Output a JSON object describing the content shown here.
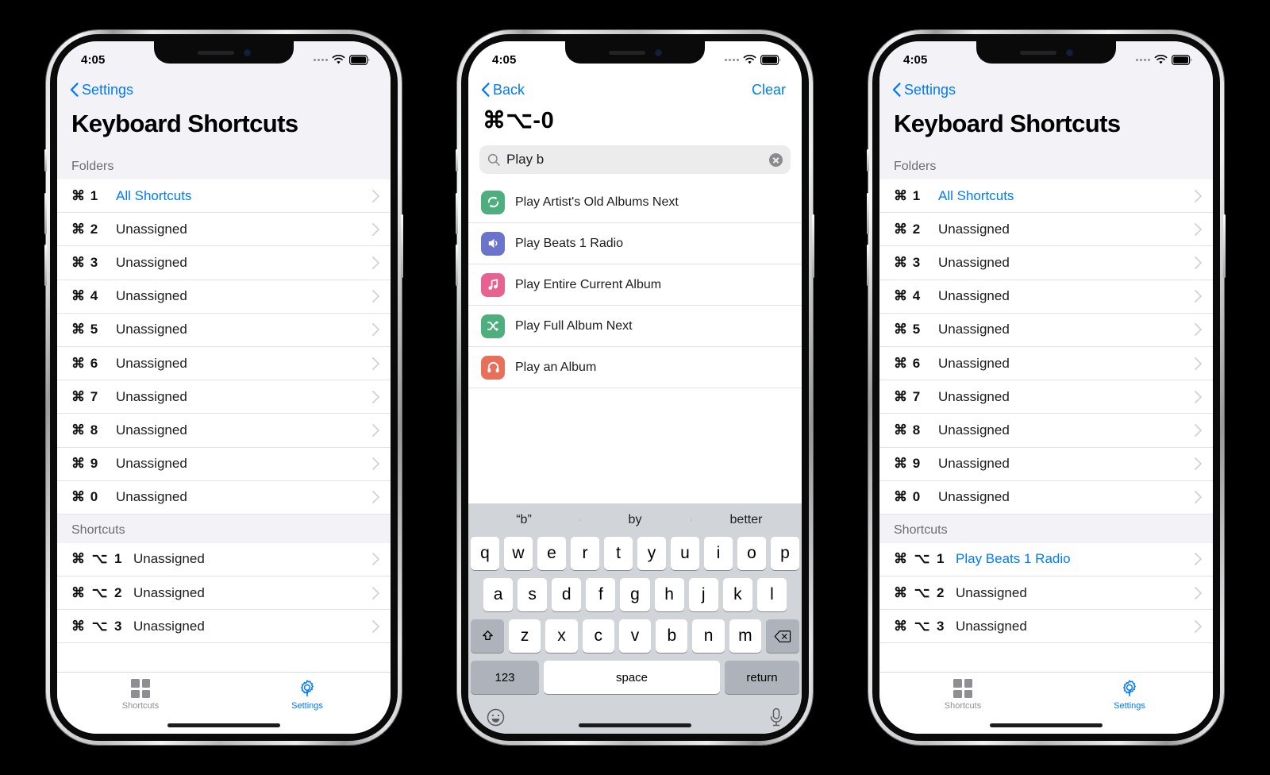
{
  "status": {
    "time": "4:05"
  },
  "phone1": {
    "nav": {
      "back_label": "Settings"
    },
    "title": "Keyboard Shortcuts",
    "sections": [
      {
        "header": "Folders",
        "rows": [
          {
            "keys": "⌘ 1",
            "label": "All Shortcuts",
            "blue": true
          },
          {
            "keys": "⌘ 2",
            "label": "Unassigned",
            "blue": false
          },
          {
            "keys": "⌘ 3",
            "label": "Unassigned",
            "blue": false
          },
          {
            "keys": "⌘ 4",
            "label": "Unassigned",
            "blue": false
          },
          {
            "keys": "⌘ 5",
            "label": "Unassigned",
            "blue": false
          },
          {
            "keys": "⌘ 6",
            "label": "Unassigned",
            "blue": false
          },
          {
            "keys": "⌘ 7",
            "label": "Unassigned",
            "blue": false
          },
          {
            "keys": "⌘ 8",
            "label": "Unassigned",
            "blue": false
          },
          {
            "keys": "⌘ 9",
            "label": "Unassigned",
            "blue": false
          },
          {
            "keys": "⌘ 0",
            "label": "Unassigned",
            "blue": false
          }
        ]
      },
      {
        "header": "Shortcuts",
        "rows": [
          {
            "keys": "⌘ ⌥ 1",
            "label": "Unassigned",
            "blue": false
          },
          {
            "keys": "⌘ ⌥ 2",
            "label": "Unassigned",
            "blue": false
          },
          {
            "keys": "⌘ ⌥ 3",
            "label": "Unassigned",
            "blue": false
          }
        ]
      }
    ],
    "tabs": [
      {
        "label": "Shortcuts",
        "icon": "grid-icon",
        "active": false
      },
      {
        "label": "Settings",
        "icon": "gear-icon",
        "active": true
      }
    ]
  },
  "phone2": {
    "nav": {
      "back_label": "Back",
      "action_label": "Clear"
    },
    "title": "⌘⌥-0",
    "search": {
      "value": "Play b",
      "placeholder": "Search"
    },
    "results": [
      {
        "label": "Play Artist's Old Albums Next",
        "icon": "refresh-icon",
        "color": "#4fae7e"
      },
      {
        "label": "Play Beats 1 Radio",
        "icon": "speaker-icon",
        "color": "#6b74ca"
      },
      {
        "label": "Play Entire Current Album",
        "icon": "music-note-icon",
        "color": "#e8628f"
      },
      {
        "label": "Play Full Album Next",
        "icon": "shuffle-icon",
        "color": "#4fae7e"
      },
      {
        "label": "Play an Album",
        "icon": "headphones-icon",
        "color": "#e8705a"
      }
    ],
    "keyboard": {
      "suggestions": [
        "“b”",
        "by",
        "better"
      ],
      "row1": [
        "q",
        "w",
        "e",
        "r",
        "t",
        "y",
        "u",
        "i",
        "o",
        "p"
      ],
      "row2": [
        "a",
        "s",
        "d",
        "f",
        "g",
        "h",
        "j",
        "k",
        "l"
      ],
      "row3": [
        "z",
        "x",
        "c",
        "v",
        "b",
        "n",
        "m"
      ],
      "numeric_label": "123",
      "space_label": "space",
      "return_label": "return"
    }
  },
  "phone3": {
    "nav": {
      "back_label": "Settings"
    },
    "title": "Keyboard Shortcuts",
    "sections": [
      {
        "header": "Folders",
        "rows": [
          {
            "keys": "⌘ 1",
            "label": "All Shortcuts",
            "blue": true
          },
          {
            "keys": "⌘ 2",
            "label": "Unassigned",
            "blue": false
          },
          {
            "keys": "⌘ 3",
            "label": "Unassigned",
            "blue": false
          },
          {
            "keys": "⌘ 4",
            "label": "Unassigned",
            "blue": false
          },
          {
            "keys": "⌘ 5",
            "label": "Unassigned",
            "blue": false
          },
          {
            "keys": "⌘ 6",
            "label": "Unassigned",
            "blue": false
          },
          {
            "keys": "⌘ 7",
            "label": "Unassigned",
            "blue": false
          },
          {
            "keys": "⌘ 8",
            "label": "Unassigned",
            "blue": false
          },
          {
            "keys": "⌘ 9",
            "label": "Unassigned",
            "blue": false
          },
          {
            "keys": "⌘ 0",
            "label": "Unassigned",
            "blue": false
          }
        ]
      },
      {
        "header": "Shortcuts",
        "rows": [
          {
            "keys": "⌘ ⌥ 1",
            "label": "Play Beats 1 Radio",
            "blue": true
          },
          {
            "keys": "⌘ ⌥ 2",
            "label": "Unassigned",
            "blue": false
          },
          {
            "keys": "⌘ ⌥ 3",
            "label": "Unassigned",
            "blue": false
          }
        ]
      }
    ],
    "tabs": [
      {
        "label": "Shortcuts",
        "icon": "grid-icon",
        "active": false
      },
      {
        "label": "Settings",
        "icon": "gear-icon",
        "active": true
      }
    ]
  },
  "colors": {
    "accent": "#007aff",
    "group_bg": "#f2f2f7",
    "separator": "#e3e3e6",
    "inactive": "#8e8e93"
  }
}
